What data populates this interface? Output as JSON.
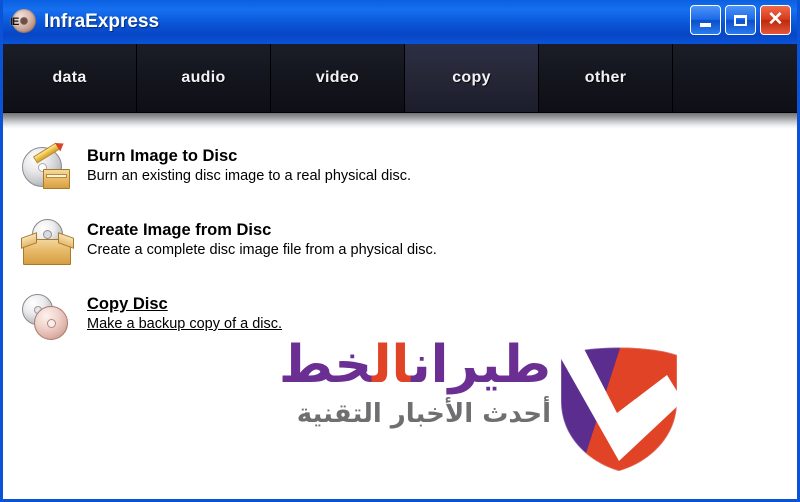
{
  "window": {
    "title": "InfraExpress",
    "icon": "disc-ie-icon",
    "controls": {
      "minimize_label": "_",
      "maximize_label": "□",
      "close_label": "✕"
    }
  },
  "tabs": [
    {
      "label": "data",
      "active": false
    },
    {
      "label": "audio",
      "active": false
    },
    {
      "label": "video",
      "active": false
    },
    {
      "label": "copy",
      "active": true
    },
    {
      "label": "other",
      "active": false
    }
  ],
  "tasks": [
    {
      "title": "Burn Image to Disc",
      "description": "Burn an existing disc image to a real physical disc.",
      "icon": "disc-pencil-box-icon",
      "hovered": false
    },
    {
      "title": "Create Image from Disc",
      "description": "Create a complete disc image file from a physical disc.",
      "icon": "disc-in-box-icon",
      "hovered": false
    },
    {
      "title": "Copy Disc",
      "description": "Make a backup copy of a disc.",
      "icon": "two-discs-icon",
      "hovered": true
    }
  ],
  "watermark": {
    "main_prefix": "خط ",
    "main_accent": "ال",
    "main_suffix": "طيران",
    "tagline": "أحدث الأخبار التقنية",
    "logo": "shield-checkmark-logo"
  },
  "colors": {
    "titlebar_blue": "#0a55d8",
    "window_border": "#0a52d6",
    "tab_inactive": "#16182 0",
    "tab_active": "#2c2e44",
    "close_red": "#d8391a",
    "watermark_purple": "#6b2f93",
    "watermark_orange": "#e04326",
    "watermark_gray": "#6f6f72",
    "content_bg": "#ffffff"
  }
}
